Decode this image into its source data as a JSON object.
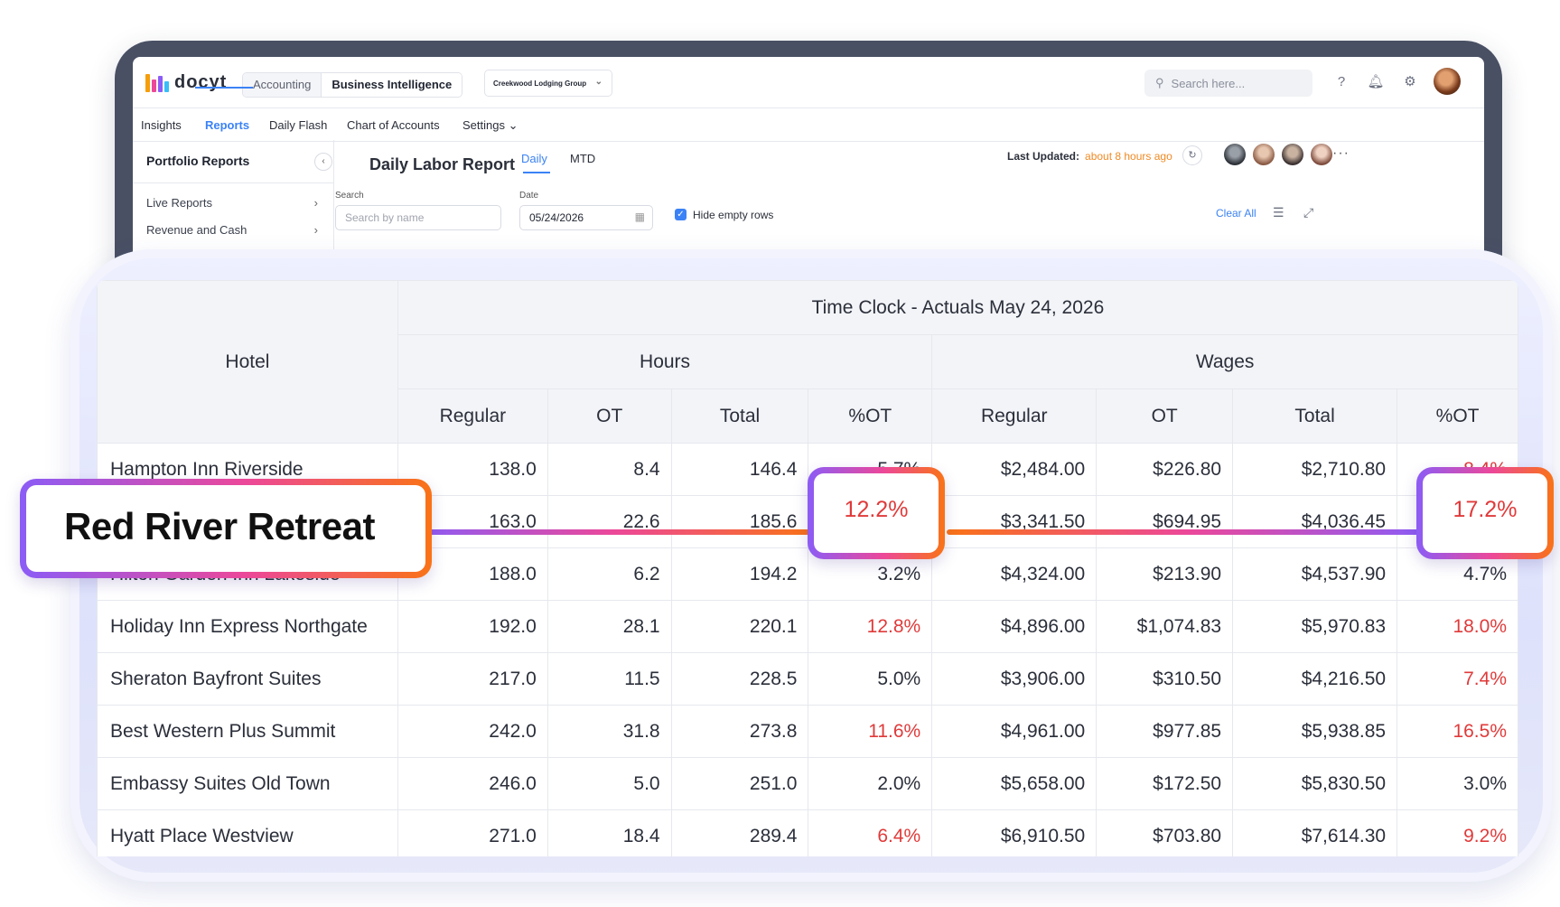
{
  "app": {
    "logo_text": "docyt",
    "segments": [
      "Accounting",
      "Business Intelligence"
    ],
    "company": "Creekwood Lodging Group",
    "search_placeholder": "Search here...",
    "tabs": [
      "Insights",
      "Reports",
      "Daily Flash",
      "Chart of Accounts",
      "Settings"
    ],
    "active_tab": "Reports",
    "sidebar": {
      "title": "Portfolio Reports",
      "items": [
        "Live Reports",
        "Revenue and Cash"
      ]
    },
    "report": {
      "title": "Daily Labor Report",
      "periods": [
        "Daily",
        "MTD"
      ],
      "active_period": "Daily",
      "last_updated_label": "Last Updated:",
      "last_updated_value": "about 8 hours ago",
      "search_label": "Search",
      "search_placeholder": "Search by name",
      "date_label": "Date",
      "date_value": "05/24/2026",
      "hide_empty_rows_label": "Hide empty rows",
      "hide_empty_rows_checked": true,
      "clear_all": "Clear All"
    },
    "colors": {
      "accent": "#3b82f6",
      "warning": "#f08a24",
      "negative": "#e03a3a"
    }
  },
  "table": {
    "title": "Time Clock - Actuals May 24, 2026",
    "hotel_header": "Hotel",
    "groups": [
      "Hours",
      "Wages"
    ],
    "columns": [
      "Regular",
      "OT",
      "Total",
      "%OT",
      "Regular",
      "OT",
      "Total",
      "%OT"
    ],
    "rows": [
      {
        "hotel": "Hampton Inn Riverside",
        "cells": [
          "138.0",
          "8.4",
          "146.4",
          "5.7%",
          "$2,484.00",
          "$226.80",
          "$2,710.80",
          "8.4%"
        ],
        "red": [
          false,
          true
        ]
      },
      {
        "hotel": "Red River Retreat",
        "cells": [
          "163.0",
          "22.6",
          "185.6",
          "12.2%",
          "$3,341.50",
          "$694.95",
          "$4,036.45",
          "17.2%"
        ],
        "red": [
          true,
          true
        ]
      },
      {
        "hotel": "Hilton Garden Inn Lakeside",
        "cells": [
          "188.0",
          "6.2",
          "194.2",
          "3.2%",
          "$4,324.00",
          "$213.90",
          "$4,537.90",
          "4.7%"
        ],
        "red": [
          false,
          false
        ]
      },
      {
        "hotel": "Holiday Inn Express Northgate",
        "cells": [
          "192.0",
          "28.1",
          "220.1",
          "12.8%",
          "$4,896.00",
          "$1,074.83",
          "$5,970.83",
          "18.0%"
        ],
        "red": [
          true,
          true
        ]
      },
      {
        "hotel": "Sheraton Bayfront Suites",
        "cells": [
          "217.0",
          "11.5",
          "228.5",
          "5.0%",
          "$3,906.00",
          "$310.50",
          "$4,216.50",
          "7.4%"
        ],
        "red": [
          false,
          true
        ]
      },
      {
        "hotel": "Best Western Plus Summit",
        "cells": [
          "242.0",
          "31.8",
          "273.8",
          "11.6%",
          "$4,961.00",
          "$977.85",
          "$5,938.85",
          "16.5%"
        ],
        "red": [
          true,
          true
        ]
      },
      {
        "hotel": "Embassy Suites Old Town",
        "cells": [
          "246.0",
          "5.0",
          "251.0",
          "2.0%",
          "$5,658.00",
          "$172.50",
          "$5,830.50",
          "3.0%"
        ],
        "red": [
          false,
          false
        ]
      },
      {
        "hotel": "Hyatt Place Westview",
        "cells": [
          "271.0",
          "18.4",
          "289.4",
          "6.4%",
          "$6,910.50",
          "$703.80",
          "$7,614.30",
          "9.2%"
        ],
        "red": [
          true,
          true
        ]
      }
    ]
  },
  "highlight": {
    "hotel": "Red River Retreat",
    "hours_pct_ot": "12.2%",
    "wages_pct_ot": "17.2%"
  }
}
